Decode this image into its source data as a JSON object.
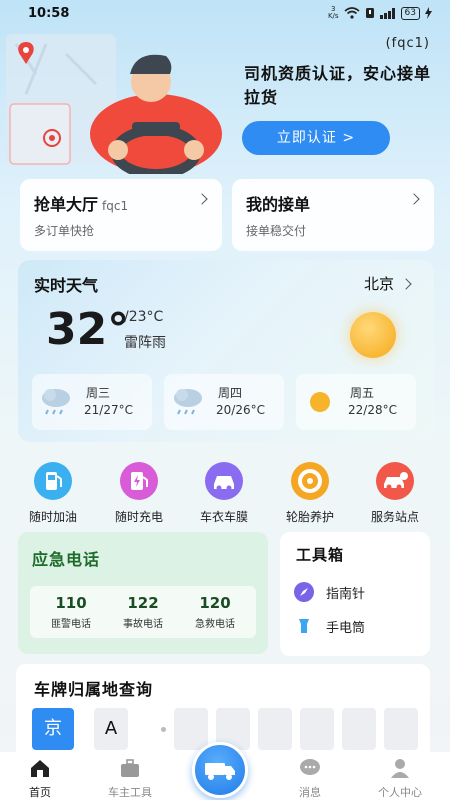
{
  "status_bar": {
    "time": "10:58",
    "network": "3",
    "network_unit": "K/s",
    "battery": "63"
  },
  "hero": {
    "user_id": "(fqc1)",
    "title": "司机资质认证，安心接单拉货",
    "button_label": "立即认证 >"
  },
  "quick_cards": [
    {
      "title": "抢单大厅",
      "tag": "fqc1",
      "subtitle": "多订单快抢"
    },
    {
      "title": "我的接单",
      "tag": "",
      "subtitle": "接单稳交付"
    }
  ],
  "weather": {
    "title": "实时天气",
    "city": "北京",
    "temp": "32°",
    "range": "/23°C",
    "condition": "雷阵雨",
    "forecast": [
      {
        "day": "周三",
        "range": "21/27°C",
        "icon": "cloud-rain-icon"
      },
      {
        "day": "周四",
        "range": "20/26°C",
        "icon": "cloud-rain-icon"
      },
      {
        "day": "周五",
        "range": "22/28°C",
        "icon": "sun-icon"
      }
    ]
  },
  "services": [
    {
      "label": "随时加油",
      "icon": "fuel-icon",
      "color": "#3ab0f0"
    },
    {
      "label": "随时充电",
      "icon": "charge-icon",
      "color": "#d85bd8"
    },
    {
      "label": "车衣车膜",
      "icon": "car-film-icon",
      "color": "#8a6cf0"
    },
    {
      "label": "轮胎养护",
      "icon": "tire-icon",
      "color": "#f5a623"
    },
    {
      "label": "服务站点",
      "icon": "service-car-icon",
      "color": "#f2584a"
    }
  ],
  "emergency": {
    "title": "应急电话",
    "items": [
      {
        "number": "110",
        "label": "匪警电话"
      },
      {
        "number": "122",
        "label": "事故电话"
      },
      {
        "number": "120",
        "label": "急救电话"
      }
    ]
  },
  "toolbox": {
    "title": "工具箱",
    "items": [
      {
        "label": "指南针",
        "icon": "compass-icon"
      },
      {
        "label": "手电筒",
        "icon": "flashlight-icon"
      }
    ]
  },
  "plate_lookup": {
    "title": "车牌归属地查询",
    "province": "京",
    "letter": "A"
  },
  "bottom_nav": [
    {
      "label": "首页",
      "icon": "home-icon",
      "active": true
    },
    {
      "label": "车主工具",
      "icon": "toolbox-icon",
      "active": false
    },
    {
      "label": "消息",
      "icon": "message-icon",
      "active": false
    },
    {
      "label": "个人中心",
      "icon": "user-icon",
      "active": false
    }
  ]
}
